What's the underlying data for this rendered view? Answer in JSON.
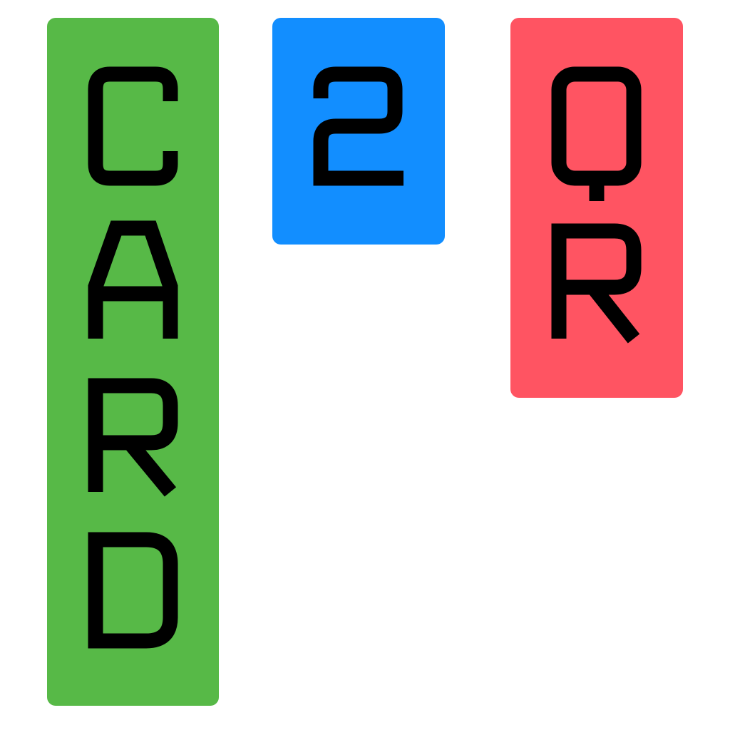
{
  "logo": {
    "words": [
      {
        "text": "CARD",
        "letters": [
          "C",
          "A",
          "R",
          "D"
        ]
      },
      {
        "text": "2",
        "letters": [
          "2"
        ]
      },
      {
        "text": "QR",
        "letters": [
          "Q",
          "R"
        ]
      }
    ]
  },
  "colors": {
    "background": "#ffffff",
    "card_tile": "#57b947",
    "two_tile": "#128eff",
    "qr_tile": "#ff5462",
    "letters": "#000000"
  }
}
